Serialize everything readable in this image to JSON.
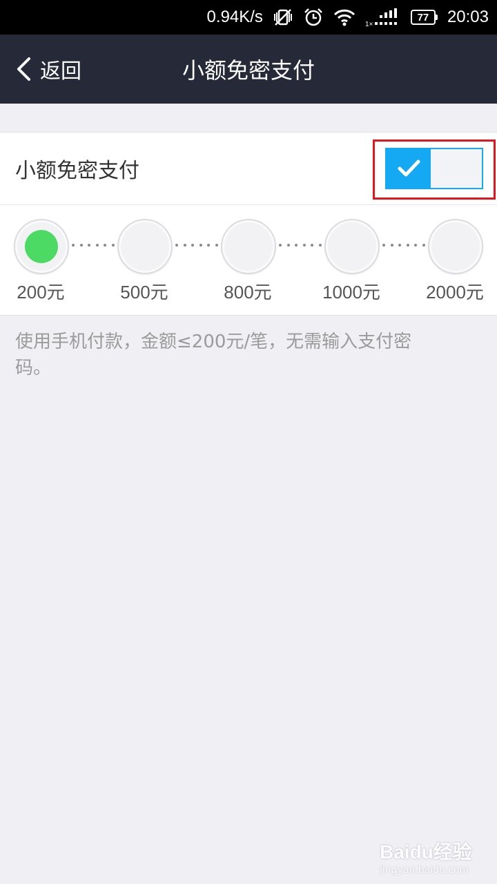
{
  "status_bar": {
    "net_speed": "0.94K/s",
    "battery": "77",
    "time": "20:03",
    "icons": [
      "vibrate-off-icon",
      "alarm-icon",
      "wifi-icon",
      "signal-icon",
      "battery-icon"
    ]
  },
  "nav": {
    "back_label": "返回",
    "title": "小额免密支付"
  },
  "toggle": {
    "label": "小额免密支付",
    "enabled": true,
    "accent_color": "#15a8f3",
    "highlight_color": "#e8141c"
  },
  "amounts": {
    "options": [
      "200元",
      "500元",
      "800元",
      "1000元",
      "2000元"
    ],
    "selected": "200元",
    "selected_color": "#4cd964"
  },
  "note": "使用手机付款，金额≤200元/笔，无需输入支付密码。",
  "watermark": {
    "brand": "Baidu经验",
    "url": "jingyan.baidu.com"
  }
}
